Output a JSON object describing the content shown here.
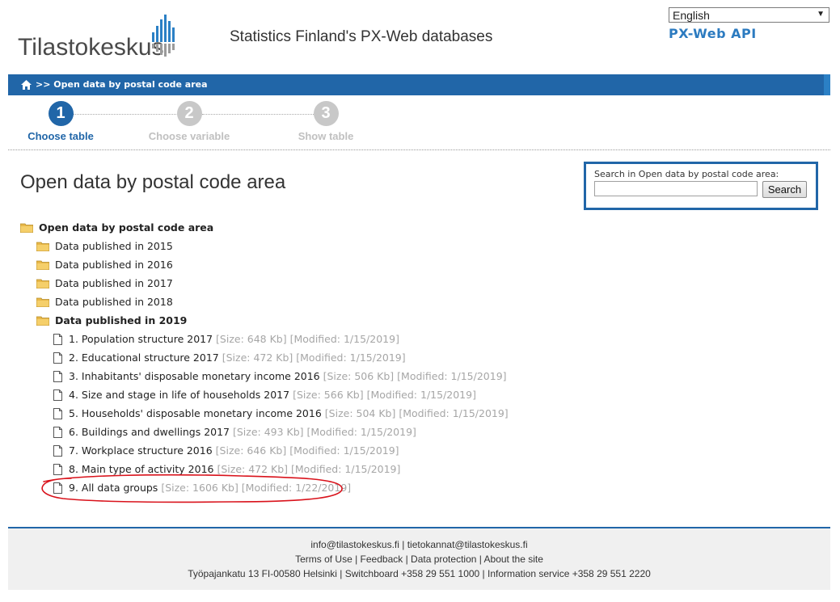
{
  "header": {
    "logo_text": "Tilastokeskus",
    "site_title": "Statistics Finland's PX-Web databases",
    "language_selected": "English",
    "api_link": "PX-Web API"
  },
  "breadcrumb": {
    "text": ">> Open data by postal code area"
  },
  "steps": [
    {
      "number": "1",
      "label": "Choose table",
      "state": "active"
    },
    {
      "number": "2",
      "label": "Choose variable",
      "state": "inactive"
    },
    {
      "number": "3",
      "label": "Show table",
      "state": "inactive"
    }
  ],
  "page_title": "Open data by postal code area",
  "search": {
    "label": "Search in Open data by postal code area:",
    "value": "",
    "button": "Search"
  },
  "tree": {
    "root": "Open data by postal code area",
    "folders": [
      {
        "label": "Data published in 2015"
      },
      {
        "label": "Data published in 2016"
      },
      {
        "label": "Data published in 2017"
      },
      {
        "label": "Data published in 2018"
      },
      {
        "label": "Data published in 2019",
        "open": true
      }
    ],
    "tables": [
      {
        "title": "1. Population structure 2017",
        "meta": "[Size: 648 Kb] [Modified: 1/15/2019]"
      },
      {
        "title": "2. Educational structure 2017",
        "meta": "[Size: 472 Kb] [Modified: 1/15/2019]"
      },
      {
        "title": "3. Inhabitants' disposable monetary income 2016",
        "meta": "[Size: 506 Kb] [Modified: 1/15/2019]"
      },
      {
        "title": "4. Size and stage in life of households 2017",
        "meta": "[Size: 566 Kb] [Modified: 1/15/2019]"
      },
      {
        "title": "5. Households' disposable monetary income 2016",
        "meta": "[Size: 504 Kb] [Modified: 1/15/2019]"
      },
      {
        "title": "6. Buildings and dwellings 2017",
        "meta": "[Size: 493 Kb] [Modified: 1/15/2019]"
      },
      {
        "title": "7. Workplace structure 2016",
        "meta": "[Size: 646 Kb] [Modified: 1/15/2019]"
      },
      {
        "title": "8. Main type of activity 2016",
        "meta": "[Size: 472 Kb] [Modified: 1/15/2019]"
      },
      {
        "title": "9. All data groups",
        "meta": "[Size: 1606 Kb] [Modified: 1/22/2019]"
      }
    ]
  },
  "footer": {
    "line1": "info@tilastokeskus.fi | tietokannat@tilastokeskus.fi",
    "line2": "Terms of Use | Feedback | Data protection | About the site",
    "line3": "Työpajankatu 13 FI-00580 Helsinki | Switchboard +358 29 551 1000 | Information service +358 29 551 2220"
  },
  "colors": {
    "brand_blue": "#2166a8",
    "link_blue": "#2c7bc0",
    "muted_gray": "#a6a6a6",
    "annotation_red": "#d9121b"
  }
}
